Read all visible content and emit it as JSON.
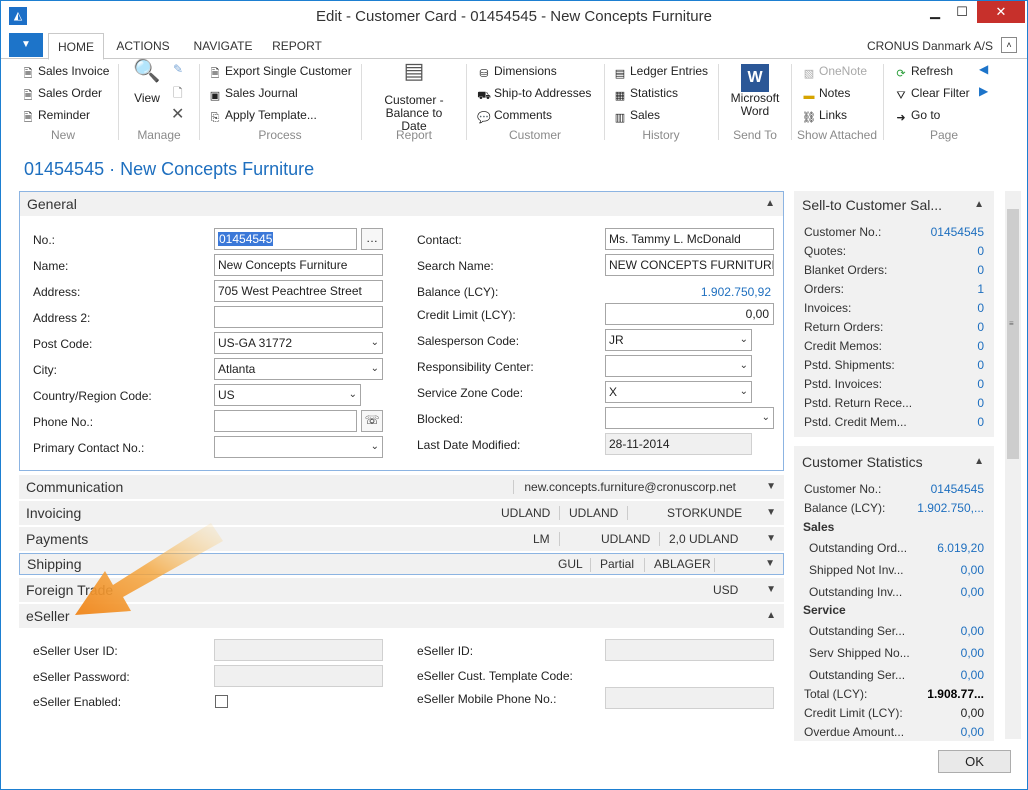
{
  "window": {
    "title": "Edit - Customer Card - 01454545 - New Concepts Furniture",
    "company": "CRONUS Danmark A/S"
  },
  "tabs": [
    "HOME",
    "ACTIONS",
    "NAVIGATE",
    "REPORT"
  ],
  "ribbon": {
    "new": {
      "title": "New",
      "items": [
        "Sales Invoice",
        "Sales Order",
        "Reminder"
      ]
    },
    "manage": {
      "title": "Manage",
      "view": "View"
    },
    "process": {
      "title": "Process",
      "items": [
        "Export Single Customer",
        "Sales Journal",
        "Apply Template..."
      ]
    },
    "report": {
      "title": "Report",
      "item": "Customer - Balance to Date"
    },
    "customer": {
      "title": "Customer",
      "items": [
        "Dimensions",
        "Ship-to Addresses",
        "Comments"
      ]
    },
    "history": {
      "title": "History",
      "items": [
        "Ledger Entries",
        "Statistics",
        "Sales"
      ]
    },
    "sendto": {
      "title": "Send To",
      "item": "Microsoft Word"
    },
    "attached": {
      "title": "Show Attached",
      "items": [
        "OneNote",
        "Notes",
        "Links"
      ]
    },
    "page": {
      "title": "Page",
      "items": [
        "Refresh",
        "Clear Filter",
        "Go to"
      ]
    }
  },
  "page_title": "01454545 · New Concepts Furniture",
  "general": {
    "title": "General",
    "no_label": "No.:",
    "no": "01454545",
    "name_label": "Name:",
    "name": "New Concepts Furniture",
    "address_label": "Address:",
    "address": "705 West Peachtree Street",
    "address2_label": "Address 2:",
    "address2": "",
    "postcode_label": "Post Code:",
    "postcode": "US-GA 31772",
    "city_label": "City:",
    "city": "Atlanta",
    "country_label": "Country/Region Code:",
    "country": "US",
    "phone_label": "Phone No.:",
    "phone": "",
    "primary_contact_label": "Primary Contact No.:",
    "primary_contact": "",
    "contact_label": "Contact:",
    "contact": "Ms. Tammy L. McDonald",
    "search_name_label": "Search Name:",
    "search_name": "NEW CONCEPTS FURNITURE",
    "balance_label": "Balance (LCY):",
    "balance": "1.902.750,92",
    "credit_limit_label": "Credit Limit (LCY):",
    "credit_limit": "0,00",
    "salesperson_label": "Salesperson Code:",
    "salesperson": "JR",
    "resp_center_label": "Responsibility Center:",
    "resp_center": "",
    "service_zone_label": "Service Zone Code:",
    "service_zone": "X",
    "blocked_label": "Blocked:",
    "blocked": "",
    "last_modified_label": "Last Date Modified:",
    "last_modified": "28-11-2014"
  },
  "fasttabs": {
    "communication": {
      "title": "Communication",
      "summary": "new.concepts.furniture@cronuscorp.net"
    },
    "invoicing": {
      "title": "Invoicing",
      "s1": "UDLAND",
      "s2": "UDLAND",
      "s3": "STORKUNDE"
    },
    "payments": {
      "title": "Payments",
      "s1": "LM",
      "s2": "UDLAND",
      "s3": "2,0 UDLAND"
    },
    "shipping": {
      "title": "Shipping",
      "s1": "GUL",
      "s2": "Partial",
      "s3": "ABLAGER"
    },
    "foreign": {
      "title": "Foreign Trade",
      "s1": "USD"
    },
    "eseller": {
      "title": "eSeller"
    }
  },
  "eseller": {
    "user_id_label": "eSeller User ID:",
    "user_id": "",
    "password_label": "eSeller Password:",
    "password": "",
    "enabled_label": "eSeller Enabled:",
    "id_label": "eSeller ID:",
    "id": "",
    "template_label": "eSeller Cust. Template Code:",
    "mobile_label": "eSeller Mobile Phone No.:",
    "mobile": ""
  },
  "factbox_sell": {
    "title": "Sell-to Customer Sal...",
    "rows": [
      {
        "label": "Customer No.:",
        "value": "01454545"
      },
      {
        "label": "Quotes:",
        "value": "0"
      },
      {
        "label": "Blanket Orders:",
        "value": "0"
      },
      {
        "label": "Orders:",
        "value": "1"
      },
      {
        "label": "Invoices:",
        "value": "0"
      },
      {
        "label": "Return Orders:",
        "value": "0"
      },
      {
        "label": "Credit Memos:",
        "value": "0"
      },
      {
        "label": "Pstd. Shipments:",
        "value": "0"
      },
      {
        "label": "Pstd. Invoices:",
        "value": "0"
      },
      {
        "label": "Pstd. Return Rece...",
        "value": "0"
      },
      {
        "label": "Pstd. Credit Mem...",
        "value": "0"
      }
    ]
  },
  "factbox_stats": {
    "title": "Customer Statistics",
    "customer_no_label": "Customer No.:",
    "customer_no": "01454545",
    "balance_label": "Balance (LCY):",
    "balance": "1.902.750,...",
    "sales_label": "Sales",
    "outstanding_orders_label": "Outstanding Ord...",
    "outstanding_orders": "6.019,20",
    "shipped_not_inv_label": "Shipped Not Inv...",
    "shipped_not_inv": "0,00",
    "outstanding_inv_label": "Outstanding Inv...",
    "outstanding_inv": "0,00",
    "service_label": "Service",
    "outstanding_ser1_label": "Outstanding Ser...",
    "outstanding_ser1": "0,00",
    "serv_shipped_label": "Serv Shipped No...",
    "serv_shipped": "0,00",
    "outstanding_ser2_label": "Outstanding Ser...",
    "outstanding_ser2": "0,00",
    "total_label": "Total (LCY):",
    "total": "1.908.77...",
    "credit_limit_label": "Credit Limit (LCY):",
    "credit_limit": "0,00",
    "overdue_label": "Overdue Amount...",
    "overdue": "0,00"
  },
  "ok_label": "OK"
}
